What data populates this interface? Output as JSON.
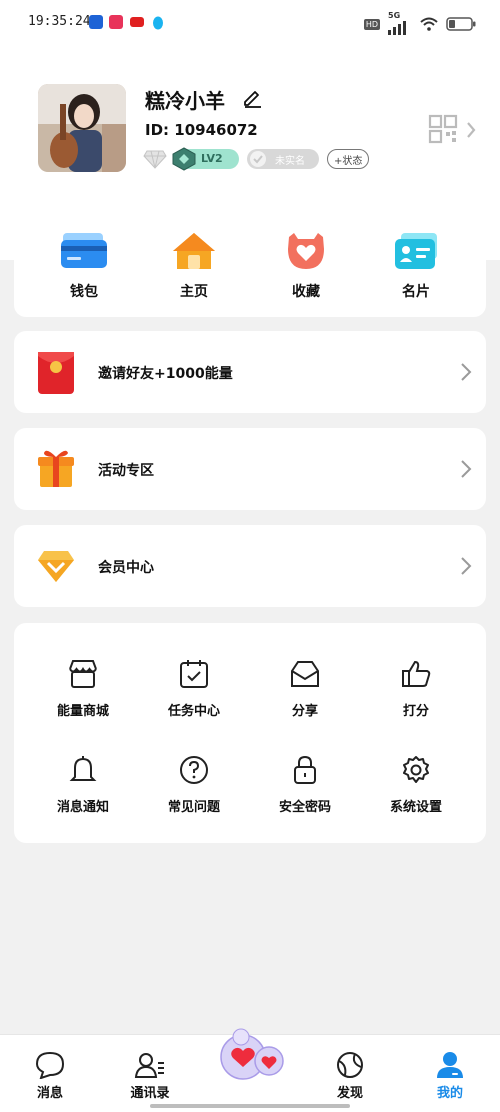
{
  "status_bar": {
    "time": "19:35:24",
    "network": "5G",
    "hd": "HD"
  },
  "profile": {
    "nickname": "糕冷小羊",
    "id_text": "ID: 10946072",
    "level": "LV2",
    "verify": "未实名",
    "status_button": "+状态"
  },
  "quick_actions": [
    {
      "label": "钱包",
      "icon": "wallet-card-icon"
    },
    {
      "label": "主页",
      "icon": "home-icon"
    },
    {
      "label": "收藏",
      "icon": "heart-favorite-icon"
    },
    {
      "label": "名片",
      "icon": "business-card-icon"
    }
  ],
  "menu_rows": [
    {
      "label": "邀请好友+1000能量",
      "icon": "red-envelope-icon"
    },
    {
      "label": "活动专区",
      "icon": "gift-box-icon"
    },
    {
      "label": "会员中心",
      "icon": "diamond-icon"
    }
  ],
  "tools": [
    {
      "label": "能量商城",
      "icon": "store-icon"
    },
    {
      "label": "任务中心",
      "icon": "calendar-check-icon"
    },
    {
      "label": "分享",
      "icon": "inbox-share-icon"
    },
    {
      "label": "打分",
      "icon": "thumbs-up-icon"
    },
    {
      "label": "消息通知",
      "icon": "bell-icon"
    },
    {
      "label": "常见问题",
      "icon": "question-icon"
    },
    {
      "label": "安全密码",
      "icon": "lock-icon"
    },
    {
      "label": "系统设置",
      "icon": "gear-icon"
    }
  ],
  "tabs": [
    {
      "label": "消息",
      "icon": "chat-bubble-icon"
    },
    {
      "label": "通讯录",
      "icon": "contacts-icon"
    },
    {
      "label": "发现",
      "icon": "globe-icon"
    },
    {
      "label": "我的",
      "icon": "user-icon",
      "active": true
    }
  ],
  "colors": {
    "accent": "#1a8be8",
    "level_badge": "#9fe3cf",
    "page_bg": "#f1f1f1"
  }
}
